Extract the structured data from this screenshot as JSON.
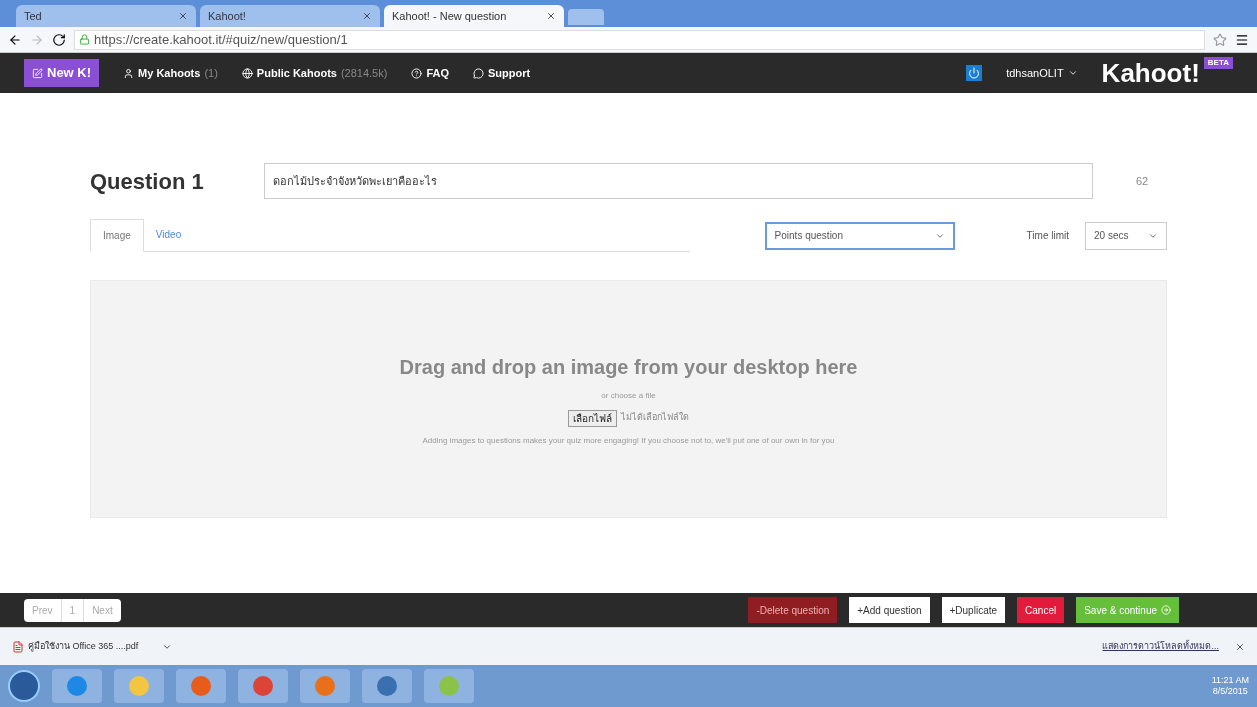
{
  "browser": {
    "tabs": [
      {
        "title": "Ted",
        "selected": false
      },
      {
        "title": "Kahoot!",
        "selected": false
      },
      {
        "title": "Kahoot! - New question",
        "selected": true
      }
    ],
    "url": "https://create.kahoot.it/#quiz/new/question/1"
  },
  "nav": {
    "new_button": "New K!",
    "items": [
      {
        "label": "My Kahoots",
        "count": "(1)"
      },
      {
        "label": "Public Kahoots",
        "count": "(2814.5k)"
      },
      {
        "label": "FAQ"
      },
      {
        "label": "Support"
      }
    ],
    "user": "tdhsanOLIT",
    "logo": "Kahoot!",
    "badge": "BETA"
  },
  "question": {
    "heading": "Question 1",
    "text": "ดอกไม้ประจำจังหวัดพะเยาคืออะไร",
    "remaining": "62"
  },
  "media_tabs": [
    {
      "label": "Image",
      "selected": true
    },
    {
      "label": "Video",
      "selected": false
    }
  ],
  "question_type": "Points question",
  "time_limit_label": "Time limit",
  "time_limit": "20 secs",
  "dropzone": {
    "title": "Drag and drop an image from your desktop here",
    "or": "or choose a file",
    "file_button": "เลือกไฟล์",
    "file_status": "ไม่ได้เลือกไฟล์ใด",
    "hint": "Adding images to questions makes your quiz more engaging! If you choose not to, we'll put one of our own in for you"
  },
  "pager": {
    "prev": "Prev",
    "page": "1",
    "next": "Next"
  },
  "actions": [
    {
      "label": "-Delete question",
      "kind": "danger"
    },
    {
      "label": "+Add question",
      "kind": "plain"
    },
    {
      "label": "+Duplicate",
      "kind": "plain"
    },
    {
      "label": "Cancel",
      "kind": "cancel"
    },
    {
      "label": "Save & continue",
      "kind": "save"
    }
  ],
  "downloads": {
    "file": "คู่มือใช้งาน Office 365 ....pdf",
    "show_all": "แสดงการดาวน์โหลดทั้งหมด..."
  },
  "taskbar": {
    "time": "11:21 AM",
    "date": "8/5/2015"
  }
}
